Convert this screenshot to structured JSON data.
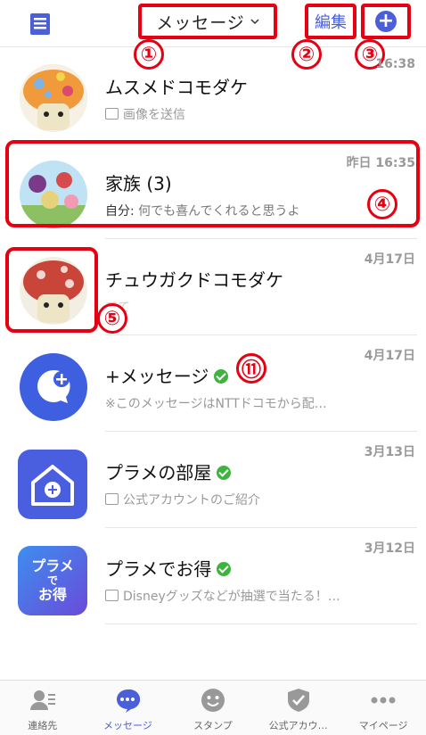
{
  "header": {
    "title": "メッセージ",
    "edit_label": "編集",
    "plus_symbol": "+",
    "icons": [
      "contacts-card-icon",
      "chevron-down-icon",
      "plus-circle-icon"
    ]
  },
  "annotations": [
    "①",
    "②",
    "③",
    "④",
    "⑤",
    "⑪"
  ],
  "threads": [
    {
      "name": "ムスメドコモダケ",
      "preview": "画像を送信",
      "date": "16:38",
      "preview_icon": "image-icon"
    },
    {
      "name": "家族 (3)",
      "preview_prefix": "自分:",
      "preview": "何でも喜んでくれると思うよ",
      "date": "昨日 16:35"
    },
    {
      "name": "チュウガクドコモダケ",
      "preview": "てて",
      "date": "4月17日"
    },
    {
      "name": "+メッセージ",
      "preview": "※このメッセージはNTTドコモから配…",
      "date": "4月17日",
      "verified": true
    },
    {
      "name": "プラメの部屋",
      "preview": "公式アカウントのご紹介",
      "date": "3月13日",
      "verified": true,
      "preview_icon": "image-icon"
    },
    {
      "name": "プラメでお得",
      "preview": "Disneyグッズなどが抽選で当たる！…",
      "date": "3月12日",
      "verified": true,
      "preview_icon": "image-icon",
      "logo_text": [
        "プラメ",
        "で",
        "お得"
      ]
    }
  ],
  "nav": [
    {
      "label": "連絡先",
      "icon": "contacts-icon"
    },
    {
      "label": "メッセージ",
      "icon": "message-bubble-icon",
      "active": true
    },
    {
      "label": "スタンプ",
      "icon": "smiley-icon"
    },
    {
      "label": "公式アカウ…",
      "icon": "shield-check-icon"
    },
    {
      "label": "マイページ",
      "icon": "more-dots-icon"
    }
  ],
  "colors": {
    "accent": "#4a5fd8",
    "annotation": "#e60012",
    "verified": "#3fb23f"
  }
}
